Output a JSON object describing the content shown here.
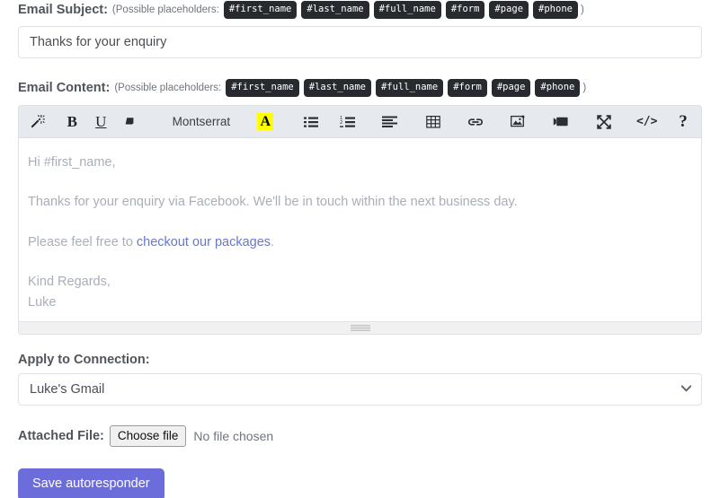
{
  "subject": {
    "label": "Email Subject:",
    "placeholders_prefix": "(Possible placeholders:",
    "placeholders_suffix": ")",
    "placeholders": [
      "#first_name",
      "#last_name",
      "#full_name",
      "#form",
      "#page",
      "#phone"
    ],
    "value": "Thanks for your enquiry",
    "input_placeholder": ""
  },
  "content": {
    "label": "Email Content:",
    "placeholders_prefix": "(Possible placeholders:",
    "placeholders_suffix": ")",
    "placeholders": [
      "#first_name",
      "#last_name",
      "#full_name",
      "#form",
      "#page",
      "#phone"
    ],
    "toolbar": {
      "magic_wand": "magic-wand-icon",
      "bold": "B",
      "underline": "U",
      "eraser": "eraser-icon",
      "font_family": "Montserrat",
      "highlight": "A",
      "bullet_list": "bullet-list-icon",
      "numbered_list": "numbered-list-icon",
      "align": "align-left-icon",
      "table": "table-icon",
      "link": "link-icon",
      "image": "image-icon",
      "video": "video-icon",
      "fullscreen": "fullscreen-icon",
      "code": "</>",
      "help": "?"
    },
    "body": {
      "line1": "Hi #first_name,",
      "line2": "Thanks for your enquiry via Facebook. We'll be in touch within the next business day.",
      "line3_prefix": "Please feel free to ",
      "line3_link": "checkout our packages",
      "line3_suffix": ".",
      "line4": "Kind Regards,",
      "line5": "Luke"
    }
  },
  "connection": {
    "label": "Apply to Connection:",
    "selected": "Luke's Gmail",
    "options": [
      "Luke's Gmail"
    ],
    "caret": "chevron-down-icon"
  },
  "attachment": {
    "label": "Attached File:",
    "choose_button": "Choose file",
    "status": "No file chosen"
  },
  "actions": {
    "save": "Save autoresponder"
  },
  "colors": {
    "accent": "#6c6ddb",
    "badge_bg": "#272b30",
    "toolbar_bg": "#e6eaee",
    "highlight": "#ffff00",
    "link": "#6677cc"
  }
}
